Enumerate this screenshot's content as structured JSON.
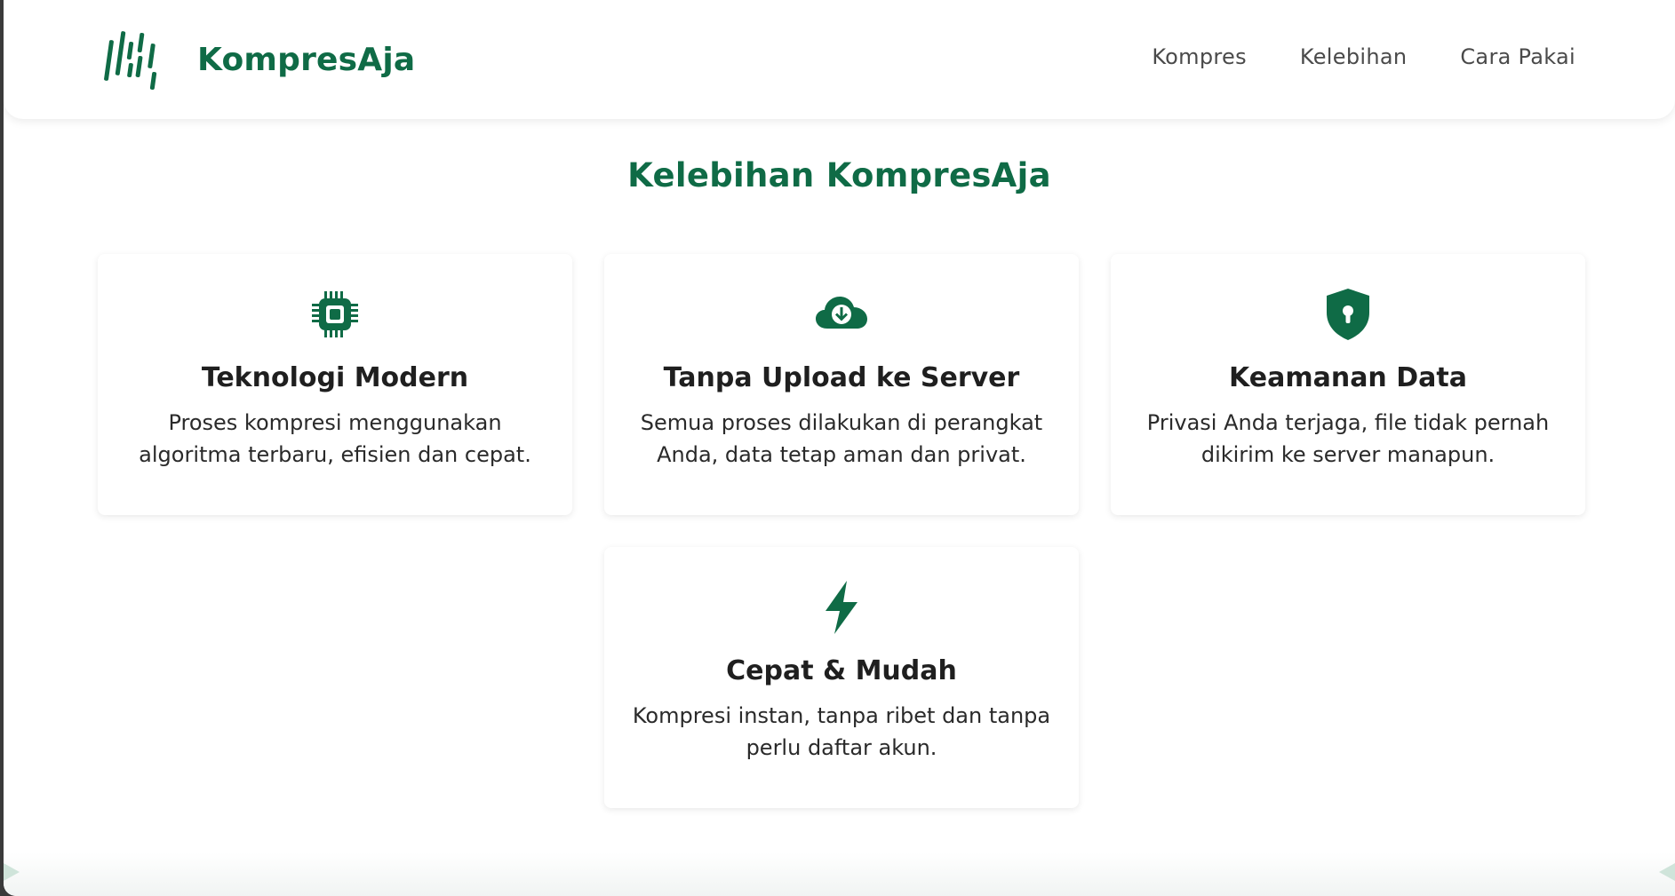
{
  "colors": {
    "brand": "#0f6b46",
    "text_dark": "#1f1f1f",
    "nav_text": "#4a4a4a"
  },
  "header": {
    "logo_icon": "stripes-logo-icon",
    "brand_name": "KompresAja",
    "nav": [
      {
        "label": "Kompres"
      },
      {
        "label": "Kelebihan"
      },
      {
        "label": "Cara Pakai"
      }
    ]
  },
  "features": {
    "title": "Kelebihan KompresAja",
    "cards": [
      {
        "icon": "chip-icon",
        "title": "Teknologi Modern",
        "desc": "Proses kompresi menggunakan algoritma terbaru, efisien dan cepat."
      },
      {
        "icon": "cloud-download-icon",
        "title": "Tanpa Upload ke Server",
        "desc": "Semua proses dilakukan di perangkat Anda, data tetap aman dan privat."
      },
      {
        "icon": "shield-lock-icon",
        "title": "Keamanan Data",
        "desc": "Privasi Anda terjaga, file tidak pernah dikirim ke server manapun."
      },
      {
        "icon": "lightning-icon",
        "title": "Cepat & Mudah",
        "desc": "Kompresi instan, tanpa ribet dan tanpa perlu daftar akun."
      }
    ]
  }
}
